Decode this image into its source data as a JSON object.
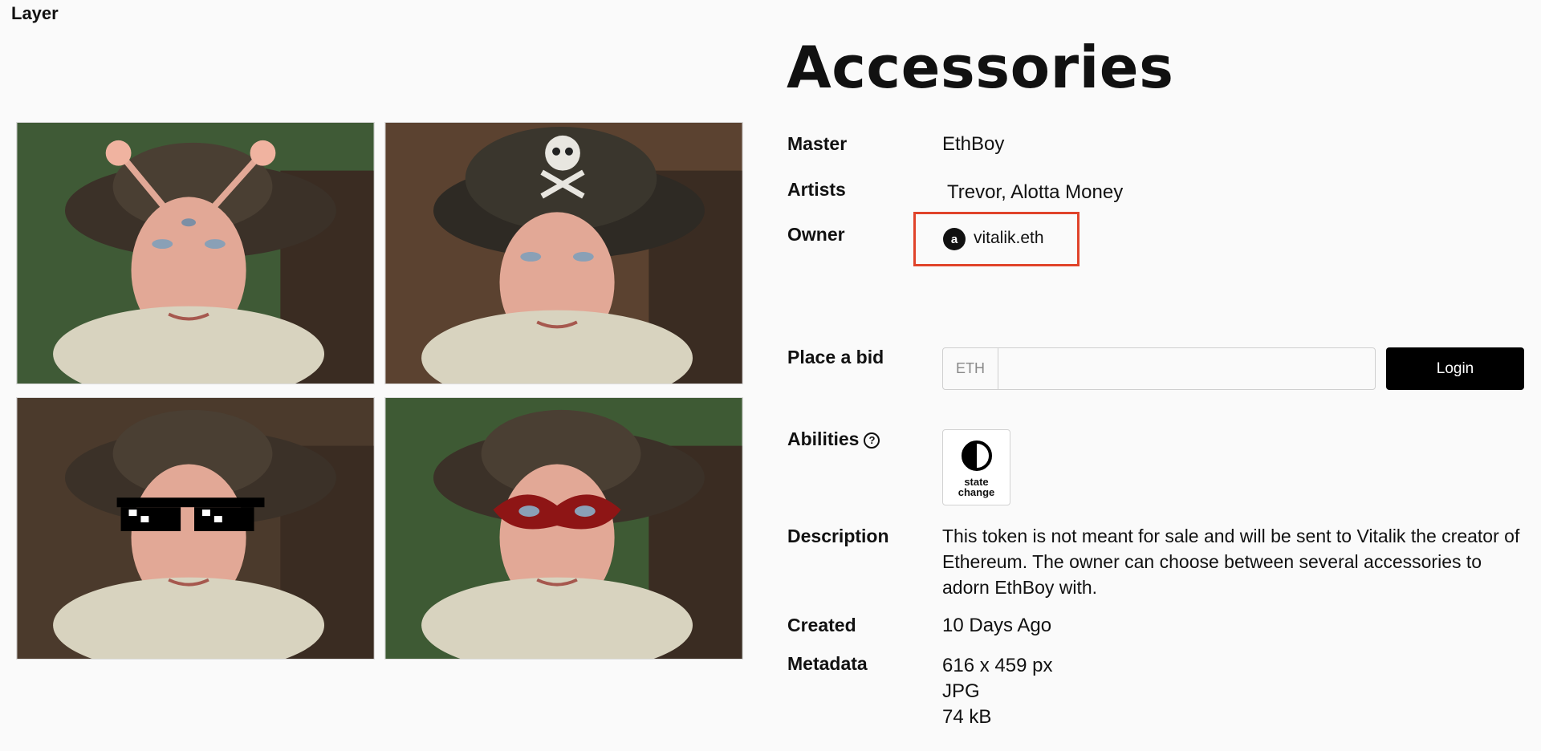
{
  "page_label": "Layer",
  "title": "Accessories",
  "fields": {
    "master": {
      "label": "Master",
      "value": "EthBoy"
    },
    "artists": {
      "label": "Artists",
      "value": "Trevor, Alotta Money"
    },
    "owner": {
      "label": "Owner",
      "value": "vitalik.eth",
      "avatar_glyph": "a"
    },
    "bid": {
      "label": "Place a bid",
      "prefix": "ETH",
      "value": "",
      "button": "Login"
    },
    "abilities": {
      "label": "Abilities",
      "help_glyph": "?",
      "items": [
        {
          "icon": "contrast-icon",
          "label": "state\nchange"
        }
      ]
    },
    "description": {
      "label": "Description",
      "value": "This token is not meant for sale and will be sent to Vitalik the creator of Ethereum. The owner can choose between several accessories to adorn EthBoy with."
    },
    "created": {
      "label": "Created",
      "value": "10 Days Ago"
    },
    "metadata": {
      "label": "Metadata",
      "lines": [
        "616 x 459 px",
        "JPG",
        "74 kB"
      ]
    }
  },
  "images": [
    {
      "accessory": "antennae-third-eye"
    },
    {
      "accessory": "pirate-hat-skull"
    },
    {
      "accessory": "pixel-sunglasses"
    },
    {
      "accessory": "red-mask"
    }
  ],
  "colors": {
    "highlight": "#e0432a",
    "button": "#000000"
  }
}
